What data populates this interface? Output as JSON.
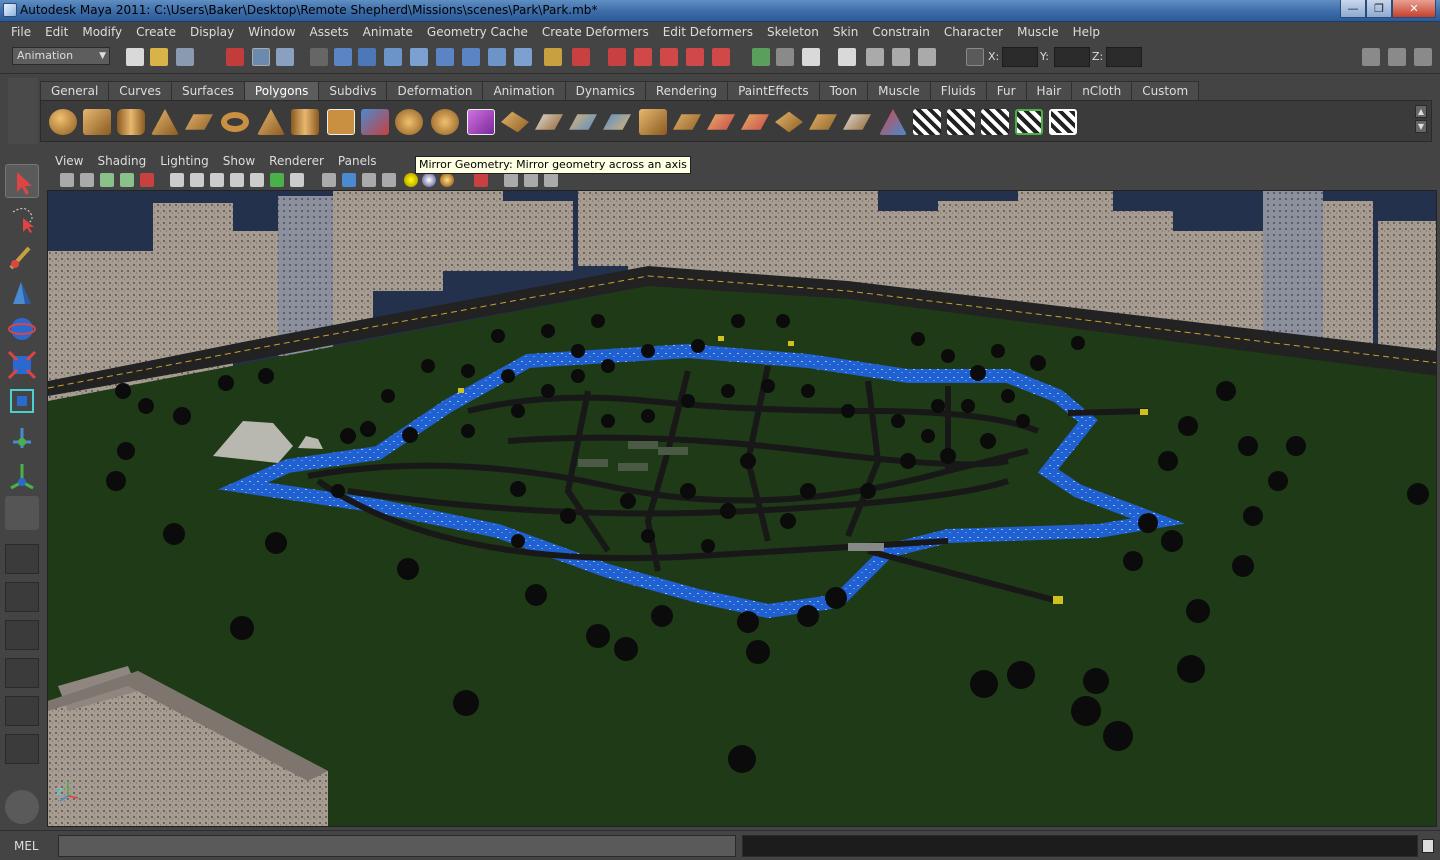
{
  "window": {
    "title": "Autodesk Maya 2011: C:\\Users\\Baker\\Desktop\\Remote Shepherd\\Missions\\scenes\\Park\\Park.mb*",
    "minimize": "—",
    "restore": "❐",
    "close": "✕"
  },
  "menubar": {
    "items": [
      "File",
      "Edit",
      "Modify",
      "Create",
      "Display",
      "Window",
      "Assets",
      "Animate",
      "Geometry Cache",
      "Create Deformers",
      "Edit Deformers",
      "Skeleton",
      "Skin",
      "Constrain",
      "Character",
      "Muscle",
      "Help"
    ]
  },
  "statusline": {
    "mode": "Animation",
    "x_label": "X:",
    "y_label": "Y:",
    "z_label": "Z:"
  },
  "shelf": {
    "tabs": [
      "General",
      "Curves",
      "Surfaces",
      "Polygons",
      "Subdivs",
      "Deformation",
      "Animation",
      "Dynamics",
      "Rendering",
      "PaintEffects",
      "Toon",
      "Muscle",
      "Fluids",
      "Fur",
      "Hair",
      "nCloth",
      "Custom"
    ],
    "active_tab": "Polygons"
  },
  "panel": {
    "menus": [
      "View",
      "Shading",
      "Lighting",
      "Show",
      "Renderer",
      "Panels"
    ]
  },
  "tooltip": {
    "text": "Mirror Geometry: Mirror geometry across an axis"
  },
  "viewport": {
    "axis_label": "Z"
  },
  "cmdline": {
    "label": "MEL"
  },
  "colors": {
    "grass": "#1f3a16",
    "river": "#2a6fd6",
    "sky": "#24314c",
    "tree": "#0b0b0b",
    "path": "#181818",
    "building": "#9a9088"
  }
}
